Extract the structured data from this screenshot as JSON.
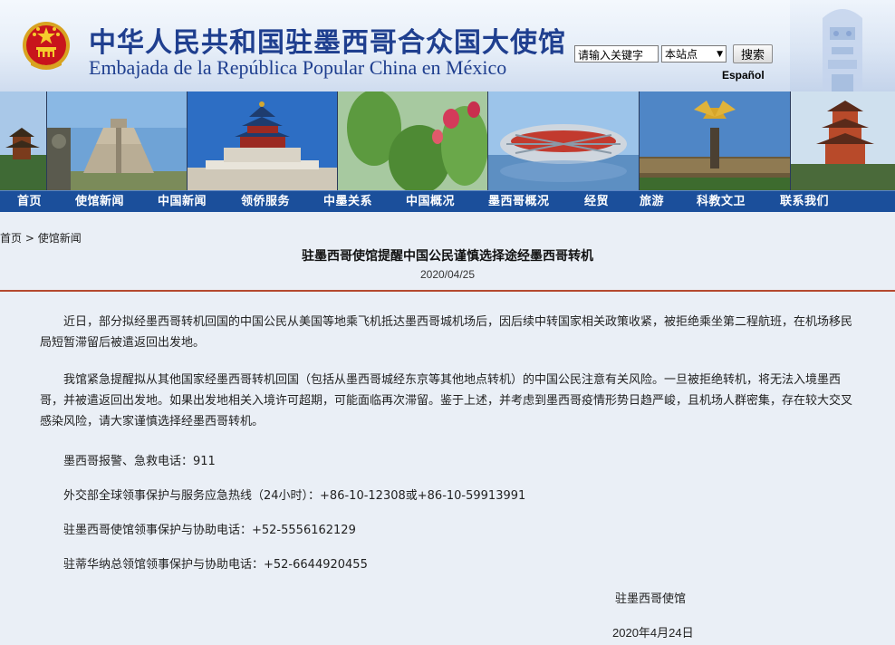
{
  "header": {
    "title_cn": "中华人民共和国驻墨西哥合众国大使馆",
    "title_es": "Embajada de la República Popular China en México",
    "search_placeholder": "请输入关键字",
    "scope_label": "本站点",
    "search_button": "搜索",
    "lang_link": "Español",
    "emblem_icon": "national-emblem-icon",
    "totem_icon": "aztec-totem-icon",
    "brand_color": "#1f3f8f"
  },
  "banner": {
    "photos": [
      "yellow-crane-tower",
      "chichen-itza-pyramid",
      "temple-of-heaven",
      "cactus-flowers",
      "birds-nest-stadium",
      "angel-of-independence",
      "yellow-crane-tower"
    ]
  },
  "nav": {
    "items": [
      "首页",
      "使馆新闻",
      "中国新闻",
      "领侨服务",
      "中墨关系",
      "中国概况",
      "墨西哥概况",
      "经贸",
      "旅游",
      "科教文卫",
      "联系我们"
    ],
    "color": "#1b4f9b"
  },
  "breadcrumb": {
    "home": "首页",
    "sep": ">",
    "section": "使馆新闻"
  },
  "article": {
    "title": "驻墨西哥使馆提醒中国公民谨慎选择途经墨西哥转机",
    "date": "2020/04/25",
    "p1": "近日，部分拟经墨西哥转机回国的中国公民从美国等地乘飞机抵达墨西哥城机场后，因后续中转国家相关政策收紧，被拒绝乘坐第二程航班，在机场移民局短暂滞留后被遣返回出发地。",
    "p2": "我馆紧急提醒拟从其他国家经墨西哥转机回国（包括从墨西哥城经东京等其他地点转机）的中国公民注意有关风险。一旦被拒绝转机，将无法入境墨西哥，并被遣返回出发地。如果出发地相关入境许可超期，可能面临再次滞留。鉴于上述，并考虑到墨西哥疫情形势日趋严峻，且机场人群密集，存在较大交叉感染风险，请大家谨慎选择经墨西哥转机。",
    "contact1": "墨西哥报警、急救电话：911",
    "contact2": "外交部全球领事保护与服务应急热线（24小时）：+86-10-12308或+86-10-59913991",
    "contact3": "驻墨西哥使馆领事保护与协助电话：+52-5556162129",
    "contact4": "驻蒂华纳总领馆领事保护与协助电话：+52-6644920455",
    "signature": "驻墨西哥使馆",
    "sign_date": "2020年4月24日",
    "rule_color": "#b5492f"
  }
}
